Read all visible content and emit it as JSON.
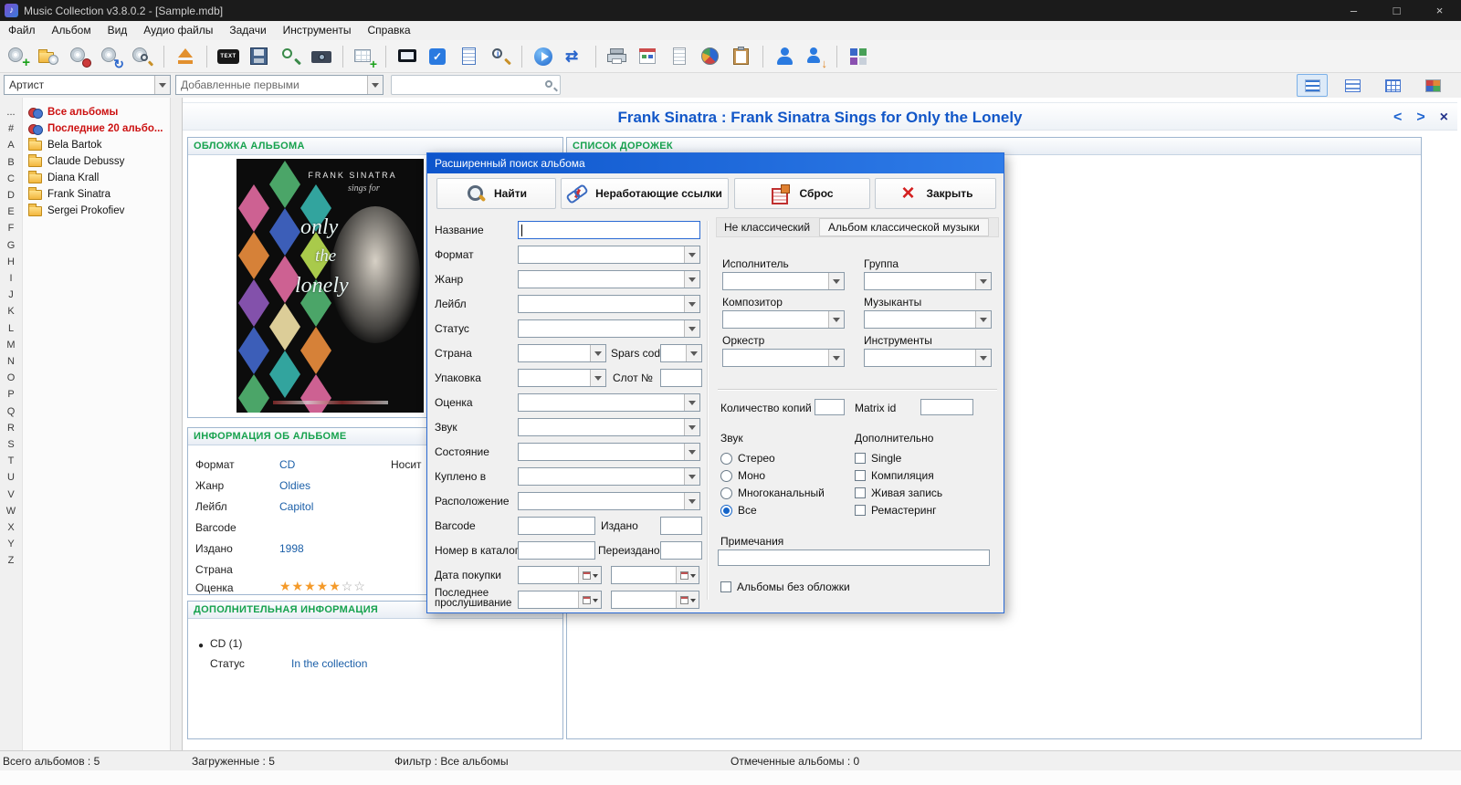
{
  "window": {
    "title": "Music Collection v3.8.0.2 - [Sample.mdb]",
    "minimize": "–",
    "maximize": "□",
    "close": "×"
  },
  "menu": {
    "items": [
      "Файл",
      "Альбом",
      "Вид",
      "Аудио файлы",
      "Задачи",
      "Инструменты",
      "Справка"
    ]
  },
  "toolbar": {
    "icons": [
      "add-album",
      "open-album-folder",
      "database-tools",
      "refresh-discs",
      "search-disc",
      "eject",
      "text-export",
      "import-save",
      "search-files",
      "snapshot",
      "add-grid",
      "screen-view",
      "tasks-check",
      "notes-page",
      "find-details",
      "play",
      "transfer",
      "print",
      "report-calendar",
      "document",
      "statistics-pie",
      "clipboard",
      "user",
      "user-export",
      "app-panes"
    ]
  },
  "filterbar": {
    "category": "Артист",
    "sort": "Добавленные первыми",
    "search_value": "",
    "views": [
      "list-view",
      "table-view",
      "grid-view",
      "tiles-view"
    ]
  },
  "alphabet": {
    "items": [
      "...",
      "#",
      "A",
      "B",
      "C",
      "D",
      "E",
      "F",
      "G",
      "H",
      "I",
      "J",
      "K",
      "L",
      "M",
      "N",
      "O",
      "P",
      "Q",
      "R",
      "S",
      "T",
      "U",
      "V",
      "W",
      "X",
      "Y",
      "Z"
    ]
  },
  "tree": {
    "items": [
      {
        "label": "Все альбомы",
        "special": true
      },
      {
        "label": "Последние 20 альбо...",
        "special": true
      },
      {
        "label": "Bela Bartok",
        "special": false
      },
      {
        "label": "Claude Debussy",
        "special": false
      },
      {
        "label": "Diana Krall",
        "special": false
      },
      {
        "label": "Frank Sinatra",
        "special": false
      },
      {
        "label": "Sergei Prokofiev",
        "special": false
      }
    ]
  },
  "album": {
    "header": "Frank Sinatra : Frank Sinatra Sings for Only the Lonely",
    "nav_prev": "<",
    "nav_next": ">",
    "nav_close": "×",
    "groups": {
      "cover": "ОБЛОЖКА АЛЬБОМА",
      "tracks": "СПИСОК ДОРОЖЕК",
      "info": "ИНФОРМАЦИЯ ОБ АЛЬБОМЕ",
      "extra": "ДОПОЛНИТЕЛЬНАЯ ИНФОРМАЦИЯ"
    },
    "cover": {
      "artist": "FRANK SINATRA",
      "subtitle": "sings for",
      "t1": "only",
      "t2": "the",
      "t3": "lonely"
    },
    "info": {
      "rows": [
        {
          "label": "Формат",
          "value": "CD"
        },
        {
          "label": "Жанр",
          "value": "Oldies"
        },
        {
          "label": "Лейбл",
          "value": "Capitol"
        },
        {
          "label": "Barcode",
          "value": ""
        },
        {
          "label": "Издано",
          "value": "1998"
        },
        {
          "label": "Страна",
          "value": ""
        },
        {
          "label": "Оценка",
          "value": ""
        }
      ],
      "col2_label": "Носит",
      "stars_filled": "★★★★★",
      "stars_empty": "☆☆"
    },
    "extra": {
      "media": "CD (1)",
      "status_label": "Статус",
      "status_value": "In the collection"
    }
  },
  "dialog": {
    "title": "Расширенный поиск альбома",
    "buttons": {
      "find": "Найти",
      "broken": "Неработающие ссылки",
      "reset": "Сброс",
      "close": "Закрыть"
    },
    "left_fields": [
      {
        "label": "Название"
      },
      {
        "label": "Формат"
      },
      {
        "label": "Жанр"
      },
      {
        "label": "Лейбл"
      },
      {
        "label": "Статус"
      },
      {
        "label": "Страна",
        "extra_label": "Spars code"
      },
      {
        "label": "Упаковка",
        "extra_label": "Слот №"
      },
      {
        "label": "Оценка"
      },
      {
        "label": "Звук"
      },
      {
        "label": "Состояние"
      },
      {
        "label": "Куплено в"
      },
      {
        "label": "Расположение"
      },
      {
        "label": "Barcode",
        "extra_label": "Издано"
      },
      {
        "label": "Номер в каталог",
        "extra_label": "Переиздано"
      },
      {
        "label": "Дата покупки"
      },
      {
        "label": "Последнее прослушивание"
      }
    ],
    "tabs": {
      "tab1": "Не классический",
      "tab2": "Альбом классической музыки"
    },
    "fields": {
      "performer": "Исполнитель",
      "group": "Группа",
      "composer": "Композитор",
      "musicians": "Музыканты",
      "orchestra": "Оркестр",
      "instruments": "Инструменты"
    },
    "copies_label": "Количество копий",
    "matrix_label": "Matrix id",
    "sound_title": "Звук",
    "sound_options": [
      "Стерео",
      "Моно",
      "Многоканальный",
      "Все"
    ],
    "sound_selected": "Все",
    "extra_title": "Дополнительно",
    "extra_options": [
      "Single",
      "Компиляция",
      "Живая запись",
      "Ремастеринг"
    ],
    "notes_label": "Примечания",
    "no_cover_label": "Альбомы без обложки"
  },
  "statusbar": {
    "total": "Всего альбомов : 5",
    "loaded": "Загруженные : 5",
    "filter": "Фильтр : Все альбомы",
    "marked": "Отмеченные альбомы : 0"
  },
  "colors": {
    "accent_blue": "#1464c8",
    "group_title_green": "#17a24e",
    "special_item_red": "#cc1111",
    "value_blue": "#1b5fa8",
    "star_orange": "#f49a2a"
  }
}
